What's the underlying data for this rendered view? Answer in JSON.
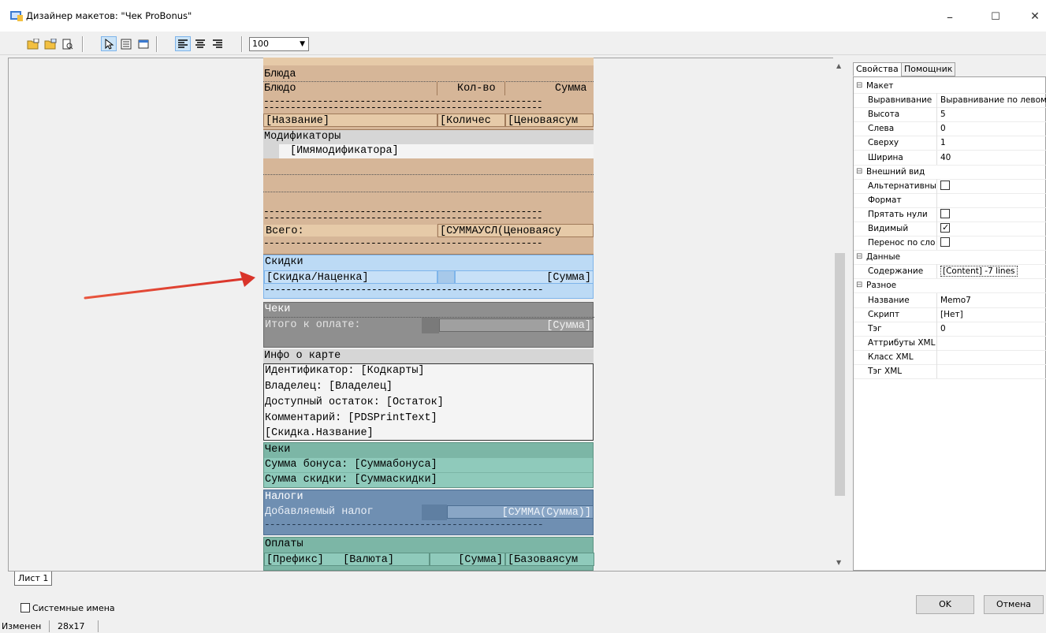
{
  "window": {
    "title": "Дизайнер макетов: \"Чек ProBonus\"",
    "minimize": "–",
    "maximize": "☐",
    "close": "✕"
  },
  "toolbar": {
    "zoom_value": "100"
  },
  "report": {
    "band1": {
      "header": "Блюда",
      "col_name": "Блюдо",
      "col_qty": "Кол-во",
      "col_sum": "Сумма",
      "f_name": "[Название]",
      "f_qty": "[Количес",
      "f_sum": "[Ценоваясум"
    },
    "modifiers": {
      "header": "Модификаторы",
      "field": "[Имямодификатора]"
    },
    "total": {
      "label": "Всего:",
      "value": "[СУММАУСЛ(Ценоваясу"
    },
    "discounts": {
      "header": "Скидки",
      "f_name": "[Скидка/Наценка]",
      "f_sum": "[Сумма]"
    },
    "checks": {
      "header": "Чеки",
      "label": "Итого к оплате:",
      "value": "[Сумма]"
    },
    "card": {
      "header": "Инфо о  карте",
      "line1": "Идентификатор: [Кодкарты]",
      "line2": "Владелец: [Владелец]",
      "line3": "Доступный остаток: [Остаток]",
      "line4": "Комментарий: [PDSPrintText]",
      "line5": "[Скидка.Название]"
    },
    "bonus": {
      "header": "Чеки",
      "line1": "Сумма бонуса: [Суммабонуса]",
      "line2": "Сумма скидки: [Суммаскидки]"
    },
    "taxes": {
      "header": "Налоги",
      "label": "Добавляемый налог",
      "value": "[СУММА(Сумма)]"
    },
    "payments": {
      "header": "Оплаты",
      "f_prefix": "[Префикс]",
      "f_currency": "[Валюта]",
      "f_sum": "[Сумма]",
      "f_base": "[Базоваясум"
    },
    "dashes": "----------------------------------------------------"
  },
  "props": {
    "tab_props": "Свойства",
    "tab_helper": "Помощник",
    "rows": [
      {
        "cat": true,
        "name": "Макет"
      },
      {
        "name": "Выравнивание",
        "value": "Выравнивание по левому"
      },
      {
        "name": "Высота",
        "value": "5"
      },
      {
        "name": "Слева",
        "value": "0"
      },
      {
        "name": "Сверху",
        "value": "1"
      },
      {
        "name": "Ширина",
        "value": "40"
      },
      {
        "cat": true,
        "name": "Внешний вид"
      },
      {
        "name": "Альтернативны",
        "check": false
      },
      {
        "name": "Формат",
        "value": ""
      },
      {
        "name": "Прятать нули",
        "check": false
      },
      {
        "name": "Видимый",
        "check": true
      },
      {
        "name": "Перенос по сло",
        "check": false
      },
      {
        "cat": true,
        "name": "Данные"
      },
      {
        "name": "Содержание",
        "value": "[Content] -7 lines",
        "boxed": true
      },
      {
        "cat": true,
        "name": "Разное"
      },
      {
        "name": "Название",
        "value": "Memo7"
      },
      {
        "name": "Скрипт",
        "value": "[Нет]"
      },
      {
        "name": "Тэг",
        "value": "0"
      },
      {
        "name": "Аттрибуты XML",
        "value": ""
      },
      {
        "name": "Класс XML",
        "value": ""
      },
      {
        "name": "Тэг XML",
        "value": ""
      }
    ]
  },
  "bottom": {
    "sheet_tab": "Лист 1",
    "system_names": "Системные имена",
    "ok": "OK",
    "cancel": "Отмена",
    "status_changed": "Изменен",
    "status_size": "28x17"
  }
}
